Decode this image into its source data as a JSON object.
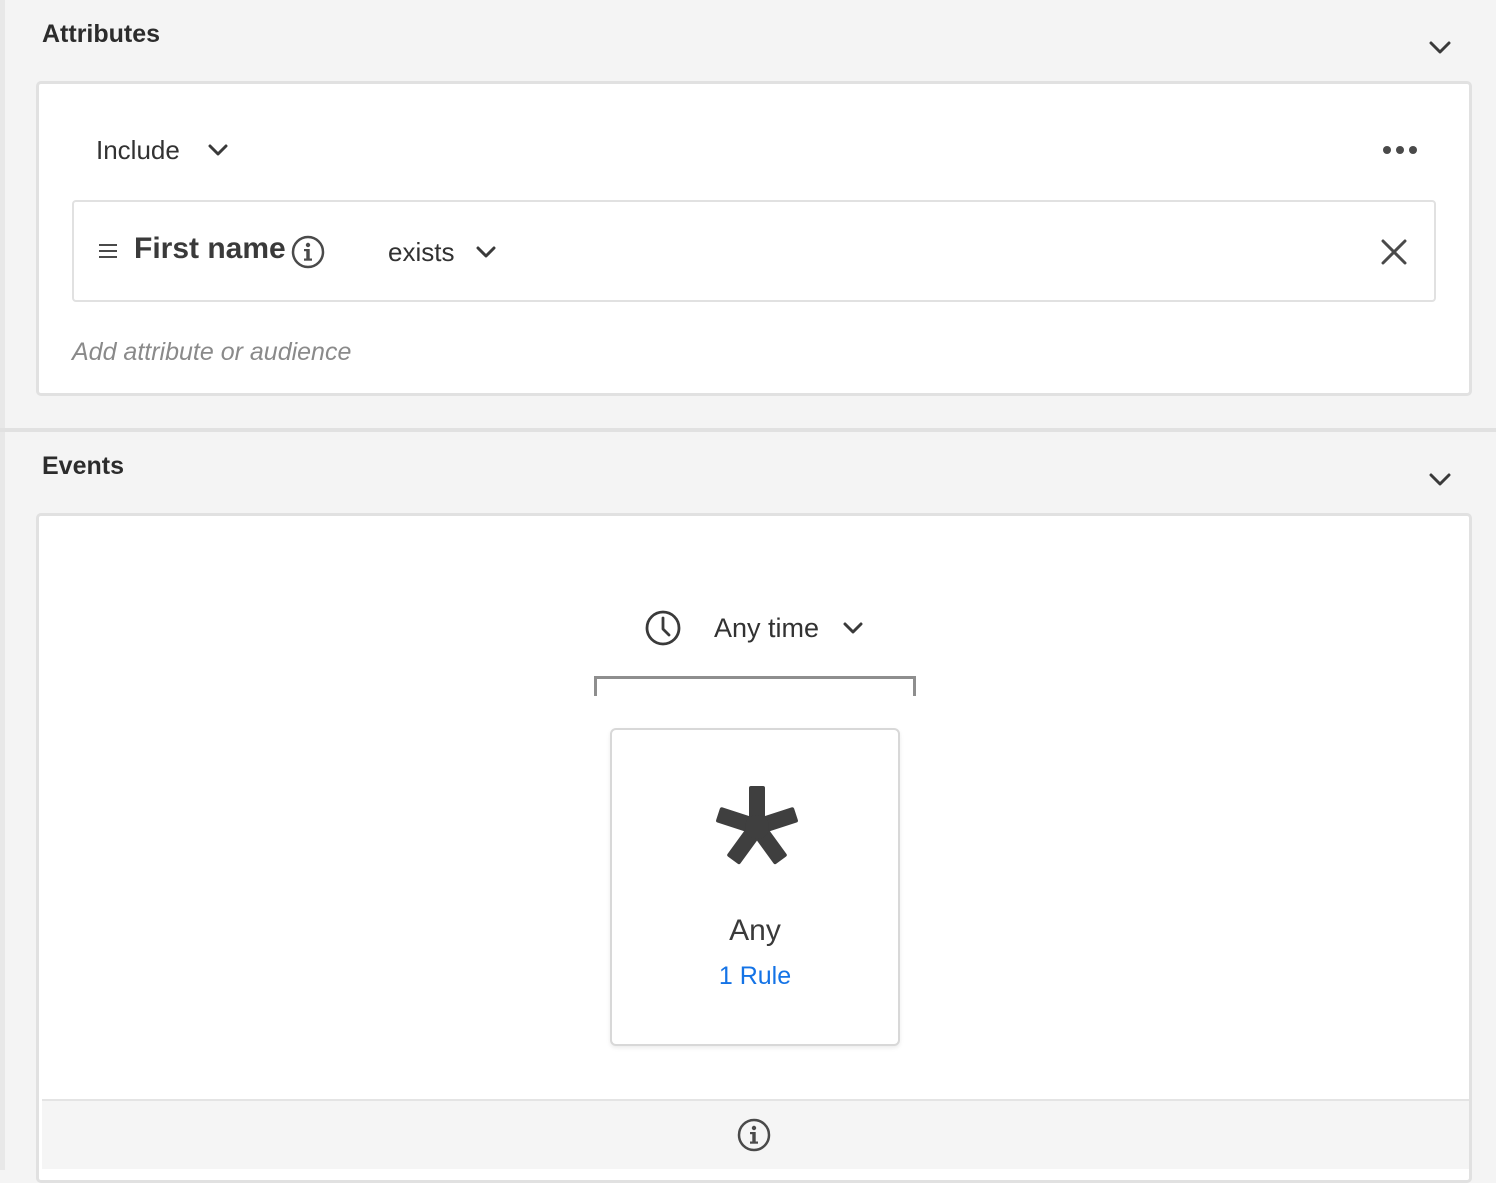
{
  "attributes": {
    "title": "Attributes",
    "collapse_icon": "chevron-down-icon",
    "include_label": "Include",
    "more_icon": "more-horizontal-icon",
    "rule": {
      "field": "First name",
      "operator": "exists",
      "info_icon": "info-icon",
      "remove_icon": "close-icon"
    },
    "add_placeholder": "Add attribute or audience"
  },
  "events": {
    "title": "Events",
    "collapse_icon": "chevron-down-icon",
    "time_label": "Any time",
    "time_icon": "clock-icon",
    "card": {
      "icon": "asterisk-icon",
      "title": "Any",
      "rule_count": "1 Rule"
    },
    "footer_icon": "info-icon"
  },
  "colors": {
    "link": "#1473e6",
    "panel_border": "#e1e1e1",
    "background": "#f4f4f4"
  }
}
